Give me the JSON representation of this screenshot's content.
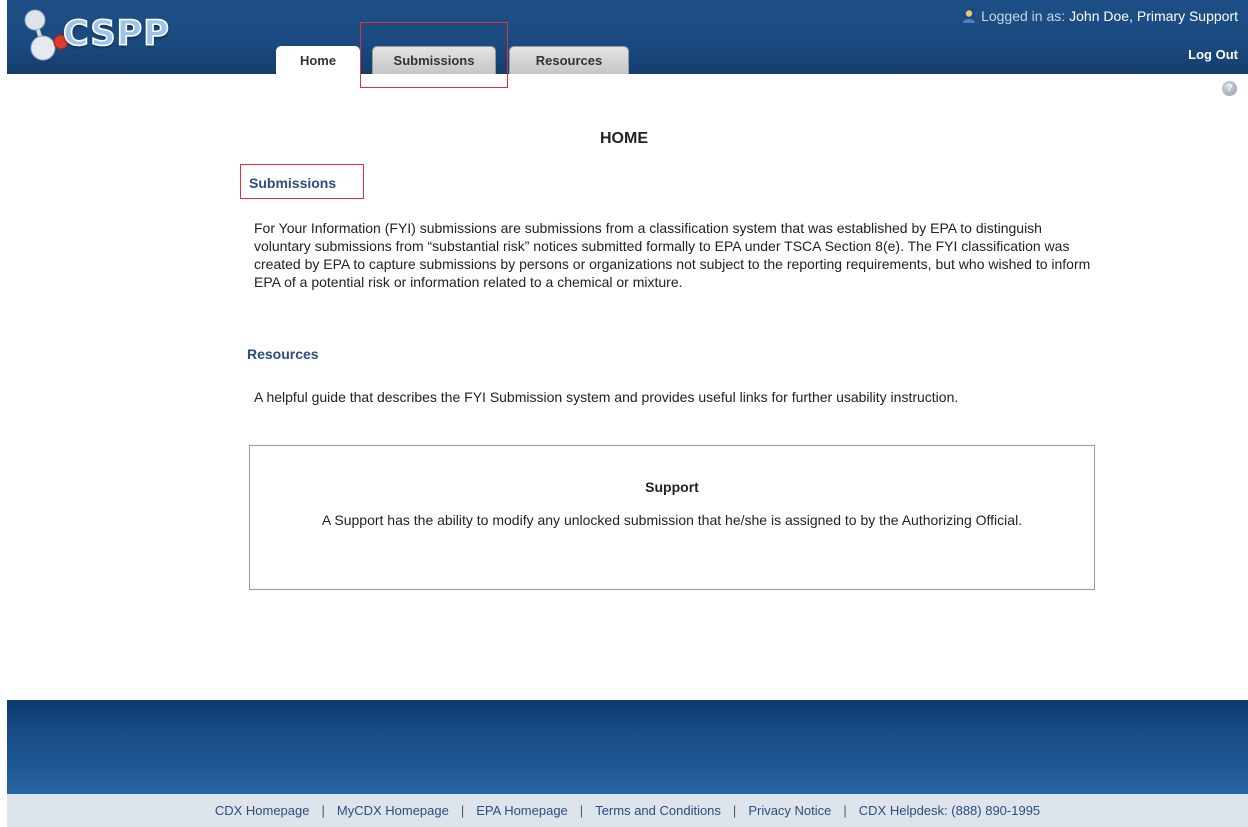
{
  "app": {
    "logo_text": "CSPP"
  },
  "header": {
    "logged_in_label": "Logged in as:",
    "user_name": "John Doe, Primary Support",
    "logout_label": "Log Out",
    "help_glyph": "?"
  },
  "tabs": [
    {
      "label": "Home",
      "active": true
    },
    {
      "label": "Submissions",
      "active": false
    },
    {
      "label": "Resources",
      "active": false
    }
  ],
  "main": {
    "title": "HOME",
    "submissions": {
      "heading": "Submissions",
      "text": "For Your Information (FYI) submissions are submissions from a classification system that was established by EPA to distinguish voluntary submissions from “substantial risk” notices submitted formally to EPA under TSCA Section 8(e). The FYI classification was created by EPA to capture submissions by persons or organizations not subject to the reporting requirements, but who wished to inform EPA of a potential risk or information related to a chemical or mixture."
    },
    "resources": {
      "heading": "Resources",
      "text": "A helpful guide that describes the FYI Submission system and provides useful links for further usability instruction."
    },
    "support_box": {
      "title": "Support",
      "text": "A Support has the ability to modify any unlocked submission that he/she is assigned to by the Authorizing Official."
    }
  },
  "footer": {
    "links": [
      "CDX Homepage",
      "MyCDX Homepage",
      "EPA Homepage",
      "Terms and Conditions",
      "Privacy Notice",
      "CDX Helpdesk: (888) 890-1995"
    ],
    "separator": "|"
  },
  "colors": {
    "header_blue": "#1a4a80",
    "heading_blue": "#2a4e80",
    "highlight_red": "#e0303a"
  }
}
